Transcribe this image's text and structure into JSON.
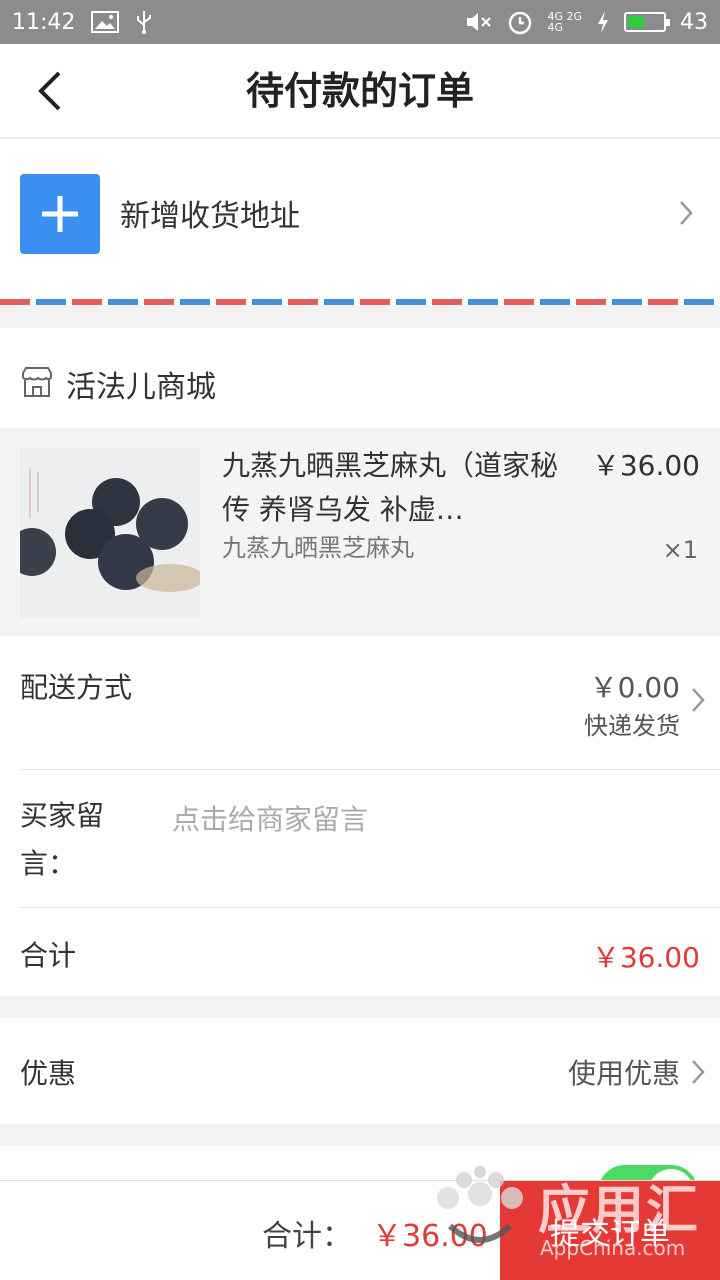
{
  "status_bar": {
    "time": "11:42",
    "network_top": "4G 2G",
    "network_bottom": "4G",
    "battery": "43",
    "icons": [
      "image-icon",
      "usb-icon",
      "mute-icon",
      "alarm-icon",
      "signal-icon",
      "charging-icon",
      "battery-icon"
    ]
  },
  "nav": {
    "title": "待付款的订单",
    "back_icon": "chevron-left-icon"
  },
  "address": {
    "label": "新增收货地址",
    "icon": "plus-icon",
    "accent_color": "#3a8ff0"
  },
  "shop": {
    "name": "活法儿商城",
    "icon": "store-icon"
  },
  "product": {
    "title": "九蒸九晒黑芝麻丸（道家秘传 养肾乌发 补虚…",
    "subtitle": "九蒸九晒黑芝麻丸",
    "price": "￥36.00",
    "quantity": "×1"
  },
  "shipping": {
    "label": "配送方式",
    "price": "￥0.00",
    "method": "快递发货"
  },
  "message": {
    "label": "买家留言：",
    "placeholder": "点击给商家留言"
  },
  "subtotal": {
    "label": "合计",
    "value": "￥36.00"
  },
  "discount": {
    "label": "优惠",
    "value": "使用优惠"
  },
  "bottom_bar": {
    "total_label": "合计：",
    "total_value": "￥36.00",
    "submit_label": "提交订单",
    "price_color": "#e03a3a",
    "button_color": "#e53935"
  },
  "watermark": {
    "text": "应用汇",
    "sub": "AppChina.com"
  }
}
